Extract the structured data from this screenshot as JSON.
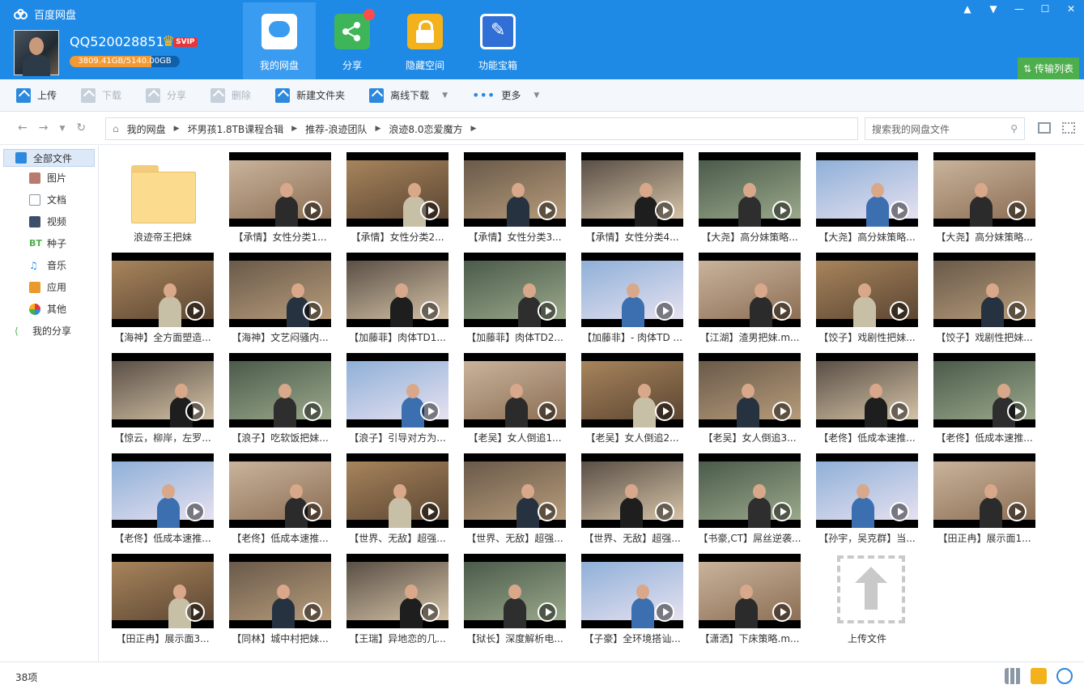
{
  "app": {
    "title": "百度网盘"
  },
  "user": {
    "name": "QQ520028851",
    "vip": "SVIP",
    "quota": "3809.41GB/5140.00GB",
    "quota_used_fraction": 0.741
  },
  "nav": [
    {
      "label": "我的网盘",
      "icon": "cloud-disk-icon",
      "active": true
    },
    {
      "label": "分享",
      "icon": "share-icon"
    },
    {
      "label": "隐藏空间",
      "icon": "lock-icon"
    },
    {
      "label": "功能宝箱",
      "icon": "toolbox-icon"
    }
  ],
  "transfer": {
    "label": "传输列表"
  },
  "toolbar": {
    "upload": "上传",
    "download": "下载",
    "share": "分享",
    "delete": "删除",
    "new_folder": "新建文件夹",
    "offline": "离线下载",
    "more": "更多"
  },
  "breadcrumb": [
    "我的网盘",
    "坏男孩1.8TB课程合辑",
    "推荐-浪迹团队",
    "浪迹8.0恋爱魔方"
  ],
  "search": {
    "placeholder": "搜索我的网盘文件"
  },
  "sidebar": {
    "all": "全部文件",
    "items": [
      "图片",
      "文档",
      "视频",
      "种子",
      "音乐",
      "应用",
      "其他"
    ],
    "bt_icon_text": "BT",
    "my_share": "我的分享"
  },
  "files": [
    {
      "name": "浪迹帝王把妹",
      "type": "folder"
    },
    {
      "name": "【承情】女性分类1...",
      "type": "video"
    },
    {
      "name": "【承情】女性分类2...",
      "type": "video"
    },
    {
      "name": "【承情】女性分类3...",
      "type": "video"
    },
    {
      "name": "【承情】女性分类4...",
      "type": "video"
    },
    {
      "name": "【大尧】高分妹策略...",
      "type": "video"
    },
    {
      "name": "【大尧】高分妹策略...",
      "type": "video"
    },
    {
      "name": "【大尧】高分妹策略...",
      "type": "video"
    },
    {
      "name": "【海神】全方面塑造...",
      "type": "video"
    },
    {
      "name": "【海神】文艺闷骚内...",
      "type": "video"
    },
    {
      "name": "【加藤菲】肉体TD1...",
      "type": "video"
    },
    {
      "name": "【加藤菲】肉体TD2...",
      "type": "video"
    },
    {
      "name": "【加藤非】- 肉体TD ...",
      "type": "video"
    },
    {
      "name": "【江湖】渣男把妹.m...",
      "type": "video"
    },
    {
      "name": "【饺子】戏剧性把妹...",
      "type": "video"
    },
    {
      "name": "【饺子】戏剧性把妹...",
      "type": "video"
    },
    {
      "name": "【惊云，柳岸，左罗...",
      "type": "video"
    },
    {
      "name": "【浪子】吃软饭把妹...",
      "type": "video"
    },
    {
      "name": "【浪子】引导对方为...",
      "type": "video"
    },
    {
      "name": "【老吴】女人倒追1...",
      "type": "video"
    },
    {
      "name": "【老吴】女人倒追2...",
      "type": "video"
    },
    {
      "name": "【老吴】女人倒追3...",
      "type": "video"
    },
    {
      "name": "【老佟】低成本速推...",
      "type": "video"
    },
    {
      "name": "【老佟】低成本速推...",
      "type": "video"
    },
    {
      "name": "【老佟】低成本速推...",
      "type": "video"
    },
    {
      "name": "【老佟】低成本速推...",
      "type": "video"
    },
    {
      "name": "【世界、无敌】超强...",
      "type": "video"
    },
    {
      "name": "【世界、无敌】超强...",
      "type": "video"
    },
    {
      "name": "【世界、无敌】超强...",
      "type": "video"
    },
    {
      "name": "【书豪,CT】屌丝逆袭...",
      "type": "video"
    },
    {
      "name": "【孙宇，吴克群】当...",
      "type": "video"
    },
    {
      "name": "【田正冉】展示面1...",
      "type": "video"
    },
    {
      "name": "【田正冉】展示面3...",
      "type": "video"
    },
    {
      "name": "【同林】城中村把妹...",
      "type": "video"
    },
    {
      "name": "【王瑞】异地恋的几...",
      "type": "video"
    },
    {
      "name": "【狱长】深度解析电...",
      "type": "video"
    },
    {
      "name": "【子豪】全环境搭讪...",
      "type": "video"
    },
    {
      "name": "【潇洒】下床策略.m...",
      "type": "video"
    }
  ],
  "upload_tile": {
    "label": "上传文件"
  },
  "status": {
    "count": "38项"
  }
}
